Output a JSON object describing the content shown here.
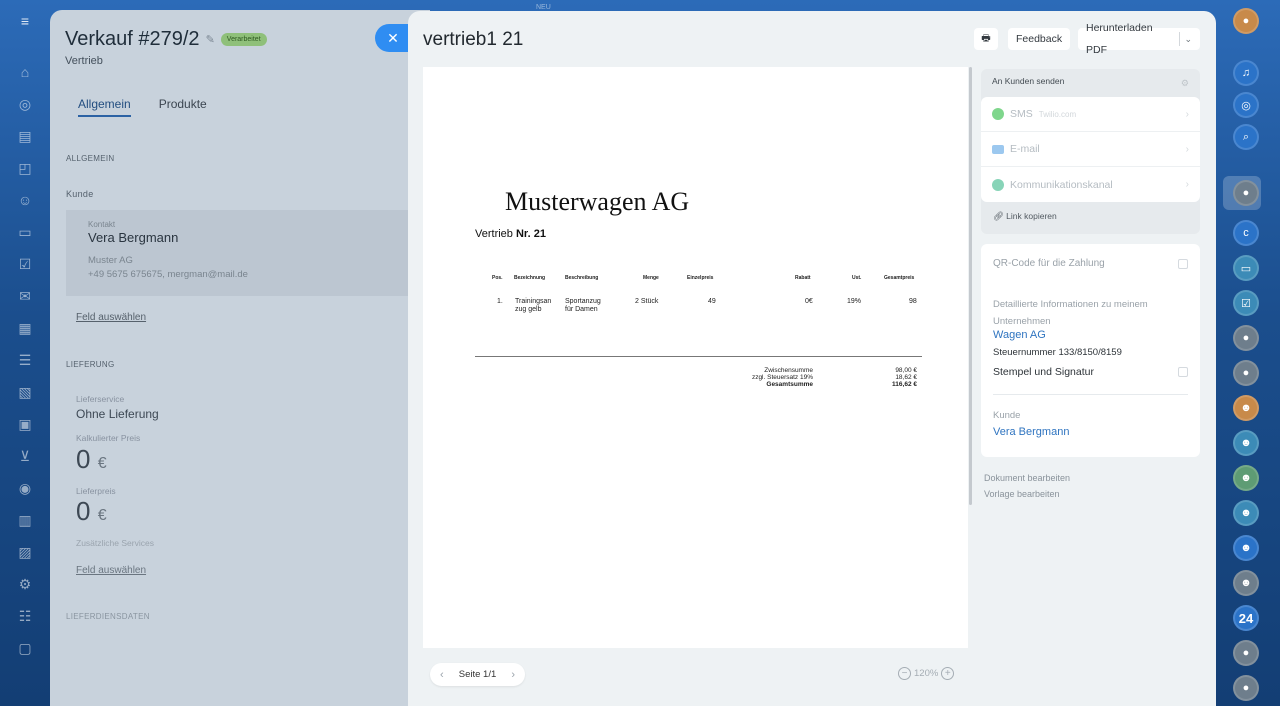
{
  "top_label": "NEU",
  "deal": {
    "title": "Verkauf #279/2",
    "badge": "Verarbeitet",
    "subtitle": "Vertrieb",
    "tabs": [
      "Allgemein",
      "Produkte"
    ],
    "section_general": "ALLGEMEIN",
    "customer_label": "Kunde",
    "contact_label": "Kontakt",
    "contact_name": "Vera Bergmann",
    "company": "Muster AG",
    "contact_info": "+49 5675 675675, mergman@mail.de",
    "select_field": "Feld auswählen",
    "section_delivery": "LIEFERUNG",
    "delivery_service_label": "Lieferservice",
    "delivery_service_value": "Ohne Lieferung",
    "calc_price_label": "Kalkulierter Preis",
    "calc_price_value": "0",
    "delivery_price_label": "Lieferpreis",
    "delivery_price_value": "0",
    "currency": "€",
    "additional_services": "Zusätzliche Services",
    "select_field_2": "Feld auswählen",
    "section_delivery_details": "LIEFERDIENSDATEN"
  },
  "header": {
    "title": "vertrieb1 21",
    "feedback": "Feedback",
    "download": "Herunterladen PDF"
  },
  "document": {
    "company": "Musterwagen AG",
    "doc_prefix": "Vertrieb ",
    "doc_number": "Nr. 21",
    "columns": [
      "Pos.",
      "Bezeichnung",
      "Beschreibung",
      "Menge",
      "Einzelpreis",
      "Rabatt",
      "Ust.",
      "Gesamtpreis"
    ],
    "row": {
      "pos": "1.",
      "name_l1": "Trainingsan",
      "name_l2": "zug gelb",
      "desc_l1": "Sportanzug",
      "desc_l2": "für Damen",
      "qty": "2 Stück",
      "unit_price": "49",
      "discount": "0€",
      "vat": "19%",
      "total": "98"
    },
    "subtotal_label": "Zwischensumme",
    "vat_label": "zzgl. Steuersatz 19%",
    "grand_label": "Gesamtsumme",
    "subtotal": "98,00 €",
    "vat_amount": "18,62 €",
    "grand_total": "116,62 €"
  },
  "pager": {
    "label": "Seite 1/1"
  },
  "zoom": {
    "value": "120%"
  },
  "send": {
    "header": "An Kunden senden",
    "sms": "SMS",
    "sms_provider": "Twilio.com",
    "email": "E-mail",
    "channel": "Kommunikationskanal",
    "copy_link": "Link kopieren"
  },
  "info": {
    "qr_label": "QR-Code für die Zahlung",
    "details_label_l1": "Detaillierte Informationen zu meinem",
    "details_label_l2": "Unternehmen",
    "company_link": "Wagen AG",
    "tax_number": "Steuernummer 133/8150/8159",
    "stamp_label": "Stempel und Signatur",
    "customer_label": "Kunde",
    "customer_link": "Vera Bergmann"
  },
  "edit": {
    "edit_document": "Dokument bearbeiten",
    "edit_template": "Vorlage bearbeiten"
  },
  "right_bar": {
    "counter": "24"
  }
}
